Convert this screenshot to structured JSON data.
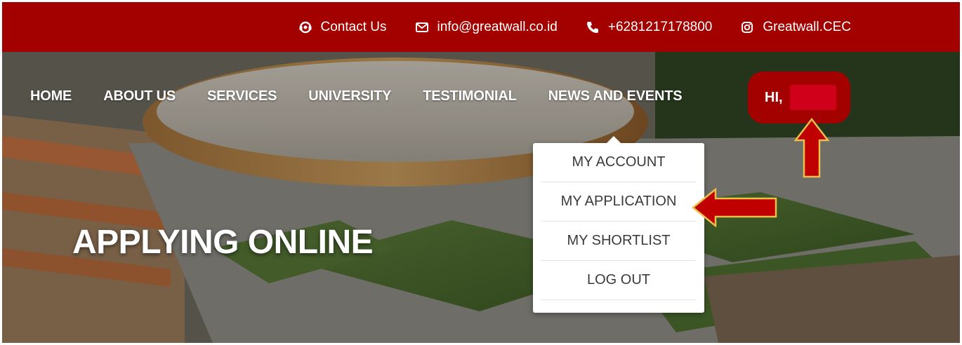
{
  "topbar": {
    "items": [
      {
        "icon": "headset-icon",
        "label": "Contact Us"
      },
      {
        "icon": "envelope-icon",
        "label": "info@greatwall.co.id"
      },
      {
        "icon": "phone-icon",
        "label": "+6281217178800"
      },
      {
        "icon": "instagram-icon",
        "label": "Greatwall.CEC"
      }
    ]
  },
  "nav": {
    "items": [
      "HOME",
      "ABOUT US",
      "SERVICES",
      "UNIVERSITY",
      "TESTIMONIAL",
      "NEWS AND EVENTS"
    ],
    "user_greeting": "HI,"
  },
  "dropdown": {
    "items": [
      "MY ACCOUNT",
      "MY APPLICATION",
      "MY SHORTLIST",
      "LOG OUT"
    ]
  },
  "hero": {
    "title": "APPLYING ONLINE"
  },
  "colors": {
    "brand_red": "#a30000",
    "highlight_red": "#c00000",
    "arrow_outline": "#e8c04a"
  }
}
